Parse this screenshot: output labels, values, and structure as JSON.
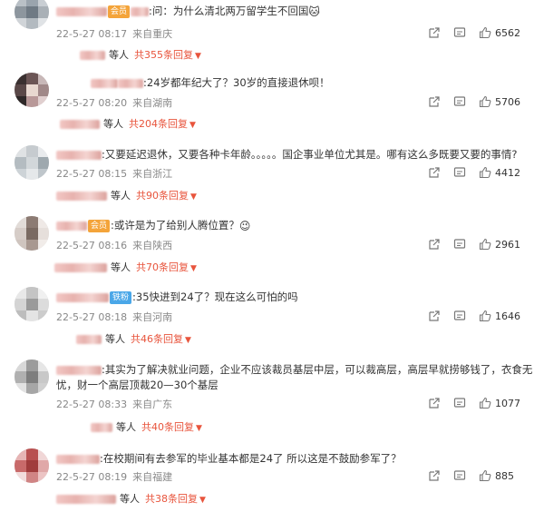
{
  "comments": [
    {
      "text": ":问：为什么清北两万留学生不回国",
      "badge": "",
      "trail_emoji": "🐱",
      "date": "22-5-27 08:17",
      "source": "来自重庆",
      "likes": "6562",
      "replies_prefix": "等人",
      "replies_count": "共355条回复"
    },
    {
      "text": ":24岁都年纪大了？30岁的直接退休呗！",
      "badge": "",
      "trail_emoji": "",
      "date": "22-5-27 08:20",
      "source": "来自湖南",
      "likes": "5706",
      "replies_prefix": "等人",
      "replies_count": "共204条回复"
    },
    {
      "text": ":又要延迟退休，又要各种卡年龄。。。。。国企事业单位尤其是。哪有这么多既要又要的事情?",
      "badge": "",
      "trail_emoji": "",
      "date": "22-5-27 08:15",
      "source": "来自浙江",
      "likes": "4412",
      "replies_prefix": "等人",
      "replies_count": "共90条回复"
    },
    {
      "text": ":或许是为了给别人腾位置？",
      "badge": "",
      "trail_emoji": "😉",
      "date": "22-5-27 08:16",
      "source": "来自陕西",
      "likes": "2961",
      "replies_prefix": "等人",
      "replies_count": "共70条回复"
    },
    {
      "text": ":35快进到24了？现在这么可怕的吗",
      "badge": "铁粉",
      "trail_emoji": "",
      "date": "22-5-27 08:18",
      "source": "来自河南",
      "likes": "1646",
      "replies_prefix": "等人",
      "replies_count": "共46条回复"
    },
    {
      "text": ":其实为了解决就业问题，企业不应该裁员基层中层，可以裁高层，高层早就捞够钱了，衣食无",
      "text2": "忧，财一个高层顶裁20—30个基层",
      "badge": "",
      "trail_emoji": "",
      "date": "22-5-27 08:33",
      "source": "来自广东",
      "likes": "1077",
      "replies_prefix": "等人",
      "replies_count": "共40条回复"
    },
    {
      "text": ":在校期间有去参军的毕业基本都是24了 所以这是不鼓励参军了？",
      "badge": "",
      "trail_emoji": "",
      "date": "22-5-27 08:19",
      "source": "来自福建",
      "likes": "885",
      "replies_prefix": "等人",
      "replies_count": "共38条回复"
    }
  ],
  "icons": {
    "share": "share-icon",
    "comment": "comment-icon",
    "like": "thumbs-up-icon",
    "expand": "caret-down-icon"
  },
  "colors": {
    "accent": "#e8543c",
    "meta": "#888888"
  }
}
